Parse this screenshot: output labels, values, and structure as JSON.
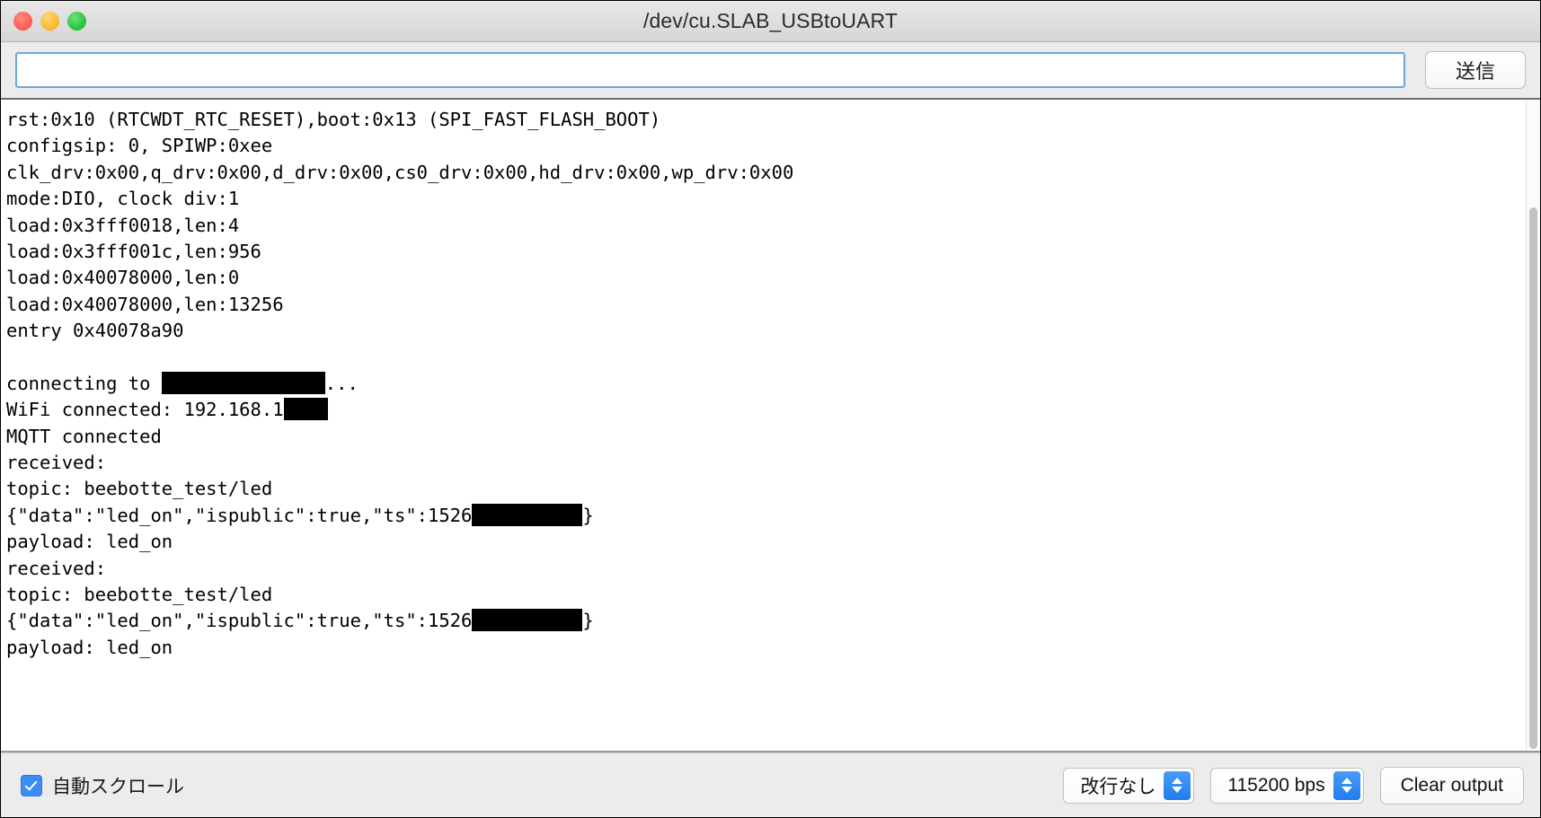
{
  "window": {
    "title": "/dev/cu.SLAB_USBtoUART",
    "traffic_lights": {
      "close_name": "close",
      "minimize_name": "minimize",
      "maximize_name": "maximize",
      "close_color": "#ff5f57",
      "minimize_color": "#febc2e",
      "maximize_color": "#28c840"
    }
  },
  "sendbar": {
    "input_value": "",
    "input_placeholder": "",
    "send_label": "送信",
    "focus_border_color": "#6ca6dd"
  },
  "console": {
    "lines": [
      {
        "text": "rst:0x10 (RTCWDT_RTC_RESET),boot:0x13 (SPI_FAST_FLASH_BOOT)"
      },
      {
        "text": "configsip: 0, SPIWP:0xee"
      },
      {
        "text": "clk_drv:0x00,q_drv:0x00,d_drv:0x00,cs0_drv:0x00,hd_drv:0x00,wp_drv:0x00"
      },
      {
        "text": "mode:DIO, clock div:1"
      },
      {
        "text": "load:0x3fff0018,len:4"
      },
      {
        "text": "load:0x3fff001c,len:956"
      },
      {
        "text": "load:0x40078000,len:0"
      },
      {
        "text": "load:0x40078000,len:13256"
      },
      {
        "text": "entry 0x40078a90"
      },
      {
        "text": ""
      },
      {
        "prefix": "connecting to ",
        "redact_width": 182,
        "suffix": "..."
      },
      {
        "prefix": "WiFi connected: 192.168.1",
        "redact_width": 49,
        "suffix": ""
      },
      {
        "text": "MQTT connected"
      },
      {
        "text": "received:"
      },
      {
        "text": "topic: beebotte_test/led"
      },
      {
        "prefix": "{\"data\":\"led_on\",\"ispublic\":true,\"ts\":1526",
        "redact_width": 123,
        "suffix": "}"
      },
      {
        "text": "payload: led_on"
      },
      {
        "text": "received:"
      },
      {
        "text": "topic: beebotte_test/led"
      },
      {
        "prefix": "{\"data\":\"led_on\",\"ispublic\":true,\"ts\":1526",
        "redact_width": 123,
        "suffix": "}"
      },
      {
        "text": "payload: led_on"
      }
    ],
    "scrollbar_name": "vertical-scrollbar"
  },
  "bottombar": {
    "autoscroll_label": "自動スクロール",
    "autoscroll_checked": true,
    "checkbox_color": "#3b8cf4",
    "line_ending_value": "改行なし",
    "baud_rate_value": "115200 bps",
    "clear_label": "Clear output"
  }
}
